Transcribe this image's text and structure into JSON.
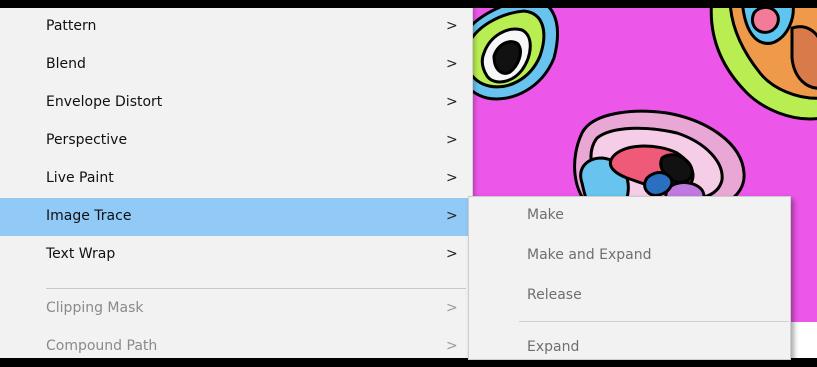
{
  "menu": {
    "items": [
      {
        "label": "Pattern",
        "chevron": ">",
        "state": "normal"
      },
      {
        "label": "Blend",
        "chevron": ">",
        "state": "normal"
      },
      {
        "label": "Envelope Distort",
        "chevron": ">",
        "state": "normal"
      },
      {
        "label": "Perspective",
        "chevron": ">",
        "state": "normal"
      },
      {
        "label": "Live Paint",
        "chevron": ">",
        "state": "normal"
      },
      {
        "label": "Image Trace",
        "chevron": ">",
        "state": "highlighted"
      },
      {
        "label": "Text Wrap",
        "chevron": ">",
        "state": "normal"
      },
      {
        "label": "Clipping Mask",
        "chevron": ">",
        "state": "disabled"
      },
      {
        "label": "Compound Path",
        "chevron": ">",
        "state": "disabled"
      }
    ]
  },
  "submenu": {
    "items": [
      {
        "label": "Make"
      },
      {
        "label": "Make and Expand"
      },
      {
        "label": "Release"
      },
      {
        "label": "Expand"
      }
    ]
  },
  "colors": {
    "menu_background": "#f2f2f2",
    "highlight": "#91c9f7",
    "canvas_background": "#ec57e9",
    "disabled_text": "#8a8a8a"
  }
}
